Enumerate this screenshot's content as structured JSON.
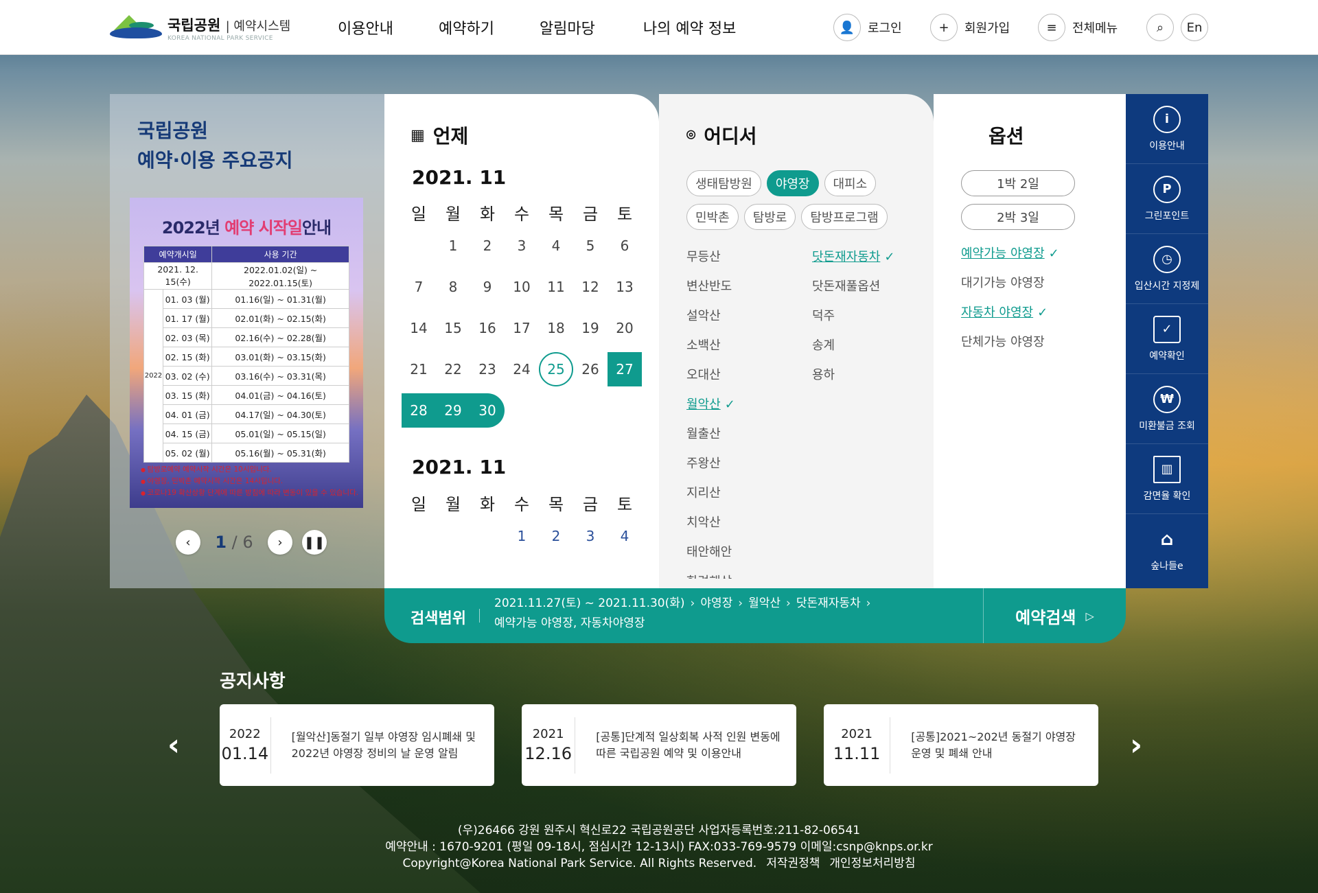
{
  "header": {
    "logo_main": "국립공원",
    "logo_sub": "예약시스템",
    "logo_en": "KOREA NATIONAL PARK SERVICE",
    "nav": [
      "이용안내",
      "예약하기",
      "알림마당",
      "나의 예약 정보"
    ],
    "login": "로그인",
    "signup": "회원가입",
    "menu": "전체메뉴",
    "lang": "En"
  },
  "notice_panel": {
    "title1": "국립공원",
    "title2": "예약·이용 주요공지",
    "poster": {
      "title_a": "2022년 ",
      "title_hl": "예약 시작일",
      " title_b": " 안내",
      "col1": "예약개시일",
      "col2": "사용 기간",
      "year": "2022",
      "rows": [
        [
          "2021. 12. 15(수)",
          "2022.01.02(일) ~ 2022.01.15(토)"
        ],
        [
          "01. 03 (월)",
          "01.16(일) ~ 01.31(월)"
        ],
        [
          "01. 17 (월)",
          "02.01(화) ~ 02.15(화)"
        ],
        [
          "02. 03 (목)",
          "02.16(수) ~ 02.28(월)"
        ],
        [
          "02. 15 (화)",
          "03.01(화) ~ 03.15(화)"
        ],
        [
          "03. 02 (수)",
          "03.16(수) ~ 03.31(목)"
        ],
        [
          "03. 15 (화)",
          "04.01(금) ~ 04.16(토)"
        ],
        [
          "04. 01 (금)",
          "04.17(일) ~ 04.30(토)"
        ],
        [
          "04. 15 (금)",
          "05.01(일) ~ 05.15(일)"
        ],
        [
          "05. 02 (월)",
          "05.16(월) ~ 05.31(화)"
        ]
      ],
      "notes": [
        "탐방로예약 예약시작 시간은 10시입니다.",
        "야영장, 민박촌 예약시작 시간은 14시입니다.",
        "코로나19 확산상황 단계에 따른 방침에 따라 변동이 있을 수 있습니다."
      ]
    },
    "pager_current": "1",
    "pager_total": "6"
  },
  "calendar": {
    "title": "언제",
    "month1": "2021. 11",
    "month2": "2021. 11",
    "weekdays": [
      "일",
      "월",
      "화",
      "수",
      "목",
      "금",
      "토"
    ]
  },
  "where": {
    "title": "어디서",
    "chips_row1": [
      "생태탐방원",
      "야영장",
      "대피소"
    ],
    "chips_row2": [
      "민박촌",
      "탐방로",
      "탐방프로그램"
    ],
    "parks": [
      "무등산",
      "변산반도",
      "설악산",
      "소백산",
      "오대산",
      "월악산",
      "월출산",
      "주왕산",
      "지리산",
      "치악산",
      "태안해안",
      "한려해상"
    ],
    "sites": [
      "닷돈재자동차",
      "닷돈재풀옵션",
      "덕주",
      "송계",
      "용하"
    ]
  },
  "option": {
    "title": "옵션",
    "stay1": "1박 2일",
    "stay2": "2박 3일",
    "list": [
      "예약가능 야영장",
      "대기가능 야영장",
      "자동차 야영장",
      "단체가능 야영장"
    ]
  },
  "quick_menu": [
    "이용안내",
    "그린포인트",
    "입산시간 지정제",
    "예약확인",
    "미환불금 조회",
    "감면율 확인",
    "숲나들e"
  ],
  "search": {
    "label": "검색범위",
    "range": "2021.11.27(토) ~ 2021.11.30(화)",
    "type": "야영장",
    "park": "월악산",
    "site": "닷돈재자동차",
    "opts": "예약가능 야영장, 자동차야영장",
    "button": "예약검색"
  },
  "notices": {
    "title": "공지사항",
    "items": [
      {
        "year": "2022",
        "date": "01.14",
        "text": "[월악산]동절기 일부 야영장 임시폐쇄 및 2022년 야영장 정비의 날 운영 알림"
      },
      {
        "year": "2021",
        "date": "12.16",
        "text": "[공통]단계적 일상회복 사적 인원 변동에 따른 국립공원 예약 및 이용안내"
      },
      {
        "year": "2021",
        "date": "11.11",
        "text": "[공통]2021~202년 동절기 야영장 운영 및 폐쇄 안내"
      }
    ]
  },
  "footer": {
    "line1": "(우)26466 강원 원주시 혁신로22 국립공원공단    사업자등록번호:211-82-06541",
    "line2": "예약안내 : 1670-9201 (평일 09-18시, 점심시간 12-13시)    FAX:033-769-9579    이메일:csnp@knps.or.kr",
    "line3": "Copyright@Korea National Park Service. All Rights Reserved.",
    "copyright_link": "저작권정책",
    "privacy_link": "개인정보처리방침"
  },
  "colors": {
    "accent": "#0f9b8e",
    "navy": "#0e3a7e"
  }
}
